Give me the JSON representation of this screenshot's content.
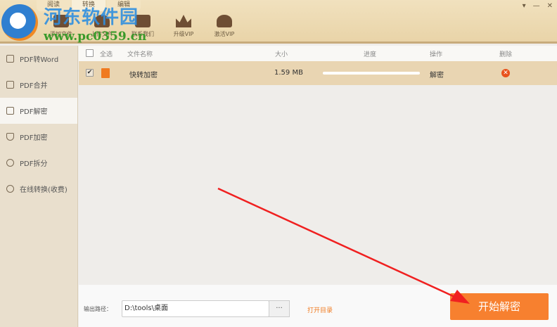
{
  "header": {
    "tabs": [
      "阅读",
      "转换",
      "编辑"
    ],
    "tools": [
      "添加文件",
      "上传文件",
      "联系我们",
      "升级VIP",
      "激活VIP"
    ],
    "window_controls": [
      "▾",
      "—",
      "✕"
    ]
  },
  "watermark": {
    "name": "河东软件园",
    "url": "www.pc0359.cn"
  },
  "sidebar": {
    "items": [
      {
        "label": "PDF转Word"
      },
      {
        "label": "PDF合并"
      },
      {
        "label": "PDF解密"
      },
      {
        "label": "PDF加密"
      },
      {
        "label": "PDF拆分"
      },
      {
        "label": "在线转换(收费)"
      }
    ]
  },
  "table": {
    "headers": {
      "select_all": "全选",
      "name": "文件名称",
      "size": "大小",
      "progress": "进度",
      "action": "操作",
      "delete": "删除"
    },
    "rows": [
      {
        "name": "快转加密",
        "size": "1.59 MB",
        "progress": 0,
        "action": "解密"
      }
    ]
  },
  "bottom": {
    "output_label": "输出路径：",
    "output_path": "D:\\tools\\桌面",
    "browse": "···",
    "open_dir": "打开目录",
    "start": "开始解密"
  },
  "colors": {
    "accent": "#f7802f",
    "arrow": "#f02020"
  }
}
